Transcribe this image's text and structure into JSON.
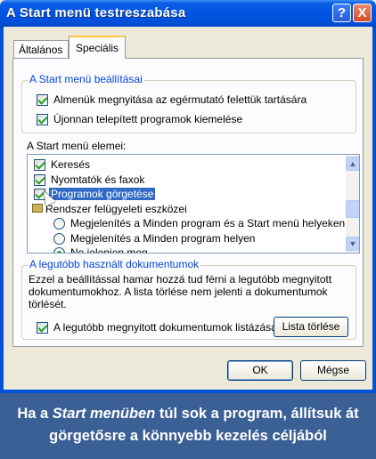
{
  "window": {
    "title": "A Start menü testreszabása"
  },
  "titlebar_buttons": {
    "help": "?",
    "close": "X"
  },
  "tabs": [
    {
      "label": "Általános"
    },
    {
      "label": "Speciális"
    }
  ],
  "settings_group": {
    "legend": "A Start menü beállításai",
    "options": [
      {
        "label": "Almenük megnyitása az egérmutató felettük tartására",
        "checked": true
      },
      {
        "label": "Újonnan telepített programok kiemelése",
        "checked": true
      }
    ]
  },
  "items_list": {
    "label": "A Start menü elemei:",
    "items": [
      {
        "label": "Keresés",
        "checked": true
      },
      {
        "label": "Nyomtatók és faxok",
        "checked": true
      },
      {
        "label": "Programok görgetése",
        "checked": true,
        "selected": true
      },
      {
        "label": "Rendszer felügyeleti eszközei",
        "icon": "tools-icon"
      },
      {
        "label": "Megjelenítés a Minden program és a Start menü helyeken",
        "radio": false
      },
      {
        "label": "Megjelenítés a Minden program helyen",
        "radio": false
      },
      {
        "label": "Ne jelenjen meg",
        "radio": true
      }
    ],
    "scroll_up": "▲",
    "scroll_down": "▼"
  },
  "recent_docs_group": {
    "legend": "A legutóbb használt dokumentumok",
    "description": [
      "Ezzel a beállítással hamar hozzá tud férni a legutóbb megnyitott",
      "dokumentumokhoz.  A lista törlése nem jelenti a dokumentumok",
      "törlését."
    ],
    "list_option": {
      "label": "A legutóbb megnyitott dokumentumok listázása",
      "checked": true
    },
    "clear_button": "Lista törlése"
  },
  "dialog_buttons": {
    "ok": "OK",
    "cancel": "Mégse"
  },
  "caption": {
    "line1_prefix": "Ha a ",
    "line1_italic": "Start menüben",
    "line1_suffix": " túl sok a program, állítsuk át",
    "line2": "görgetősre a könnyebb kezelés céljából"
  },
  "colors": {
    "titlebar": "#0054e3",
    "dialog_bg": "#ece9d8",
    "legend_text": "#0046d5",
    "selection": "#316ac5",
    "caption_bg": "#3b6096"
  }
}
